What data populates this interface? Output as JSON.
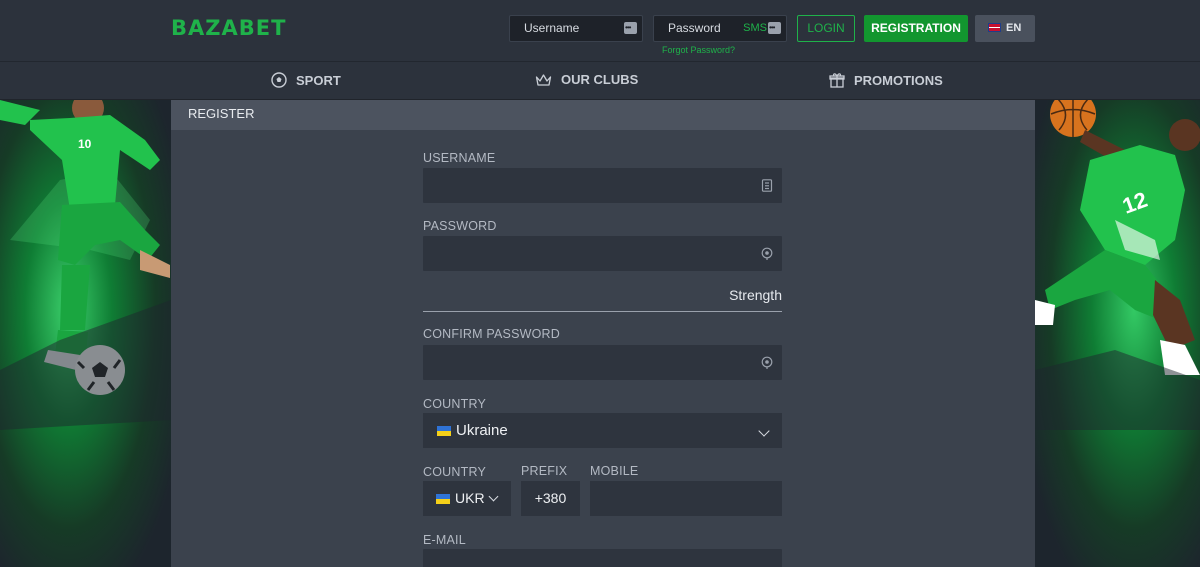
{
  "header": {
    "logo": "BAZABET",
    "username_placeholder": "Username",
    "password_placeholder": "Password",
    "sms_label": "SMS",
    "forgot_password": "Forgot Password?",
    "login_label": "LOGIN",
    "registration_label": "REGISTRATION",
    "language": "EN"
  },
  "nav": {
    "items": [
      {
        "label": "SPORT",
        "icon": "soccer-ball-icon"
      },
      {
        "label": "OUR CLUBS",
        "icon": "crown-icon"
      },
      {
        "label": "PROMOTIONS",
        "icon": "gift-icon"
      }
    ]
  },
  "form": {
    "title": "REGISTER",
    "username_label": "USERNAME",
    "password_label": "PASSWORD",
    "strength_label": "Strength",
    "confirm_password_label": "CONFIRM PASSWORD",
    "country_label": "COUNTRY",
    "country_value": "Ukraine",
    "phone_country_label": "COUNTRY",
    "phone_country_value": "UKR",
    "prefix_label": "PREFIX",
    "prefix_value": "+380",
    "mobile_label": "MOBILE",
    "email_label": "E-MAIL"
  },
  "colors": {
    "brand_green": "#1fb24a",
    "registration_button": "#12962f",
    "background": "#2b313b",
    "panel": "#3b424d",
    "field": "#2e343e"
  }
}
